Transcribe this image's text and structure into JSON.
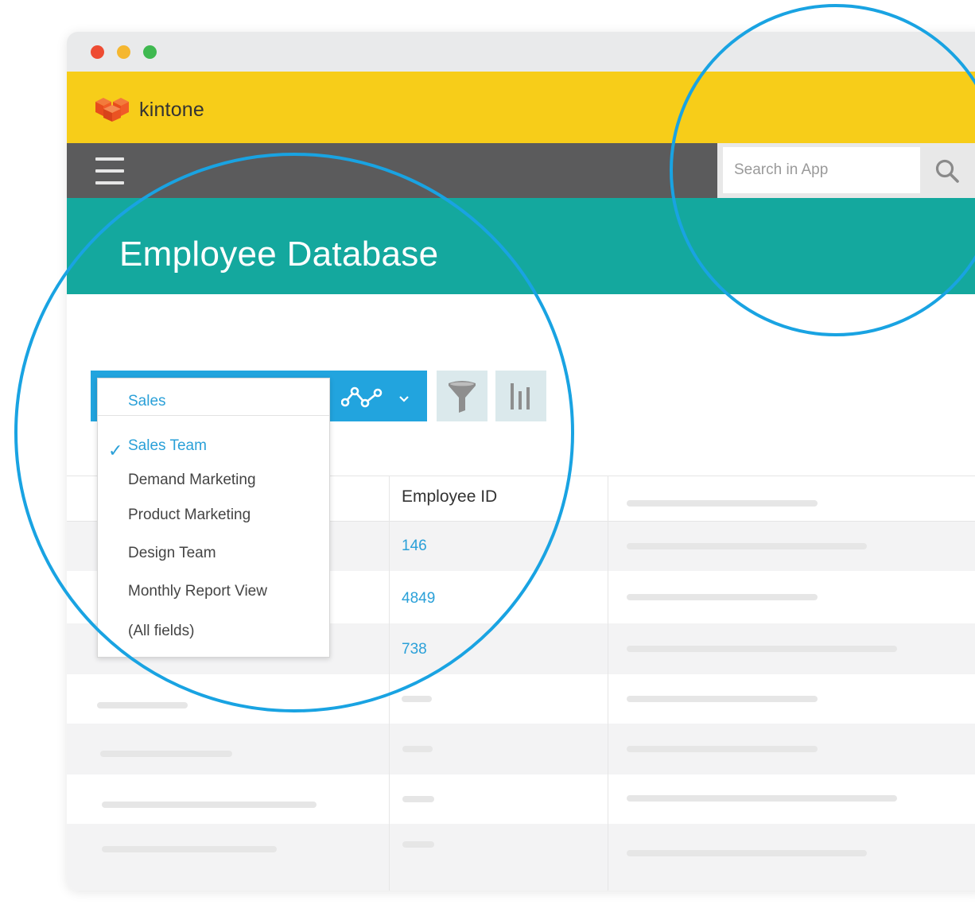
{
  "window": {
    "controls": [
      "close-control",
      "minimize-control",
      "maximize-control"
    ]
  },
  "brand": {
    "name": "kintone",
    "icon": "kintone-logo-icon",
    "logo_color": "#f05a28",
    "bar_color": "#f7cd19"
  },
  "nav": {
    "menu_icon": "hamburger-menu-icon",
    "search_placeholder": "Search in App",
    "search_icon": "search-icon"
  },
  "page": {
    "title": "Employee Database",
    "header_color": "#14a89e"
  },
  "toolbar": {
    "accent_color": "#22a4de",
    "graph_icon": "graph-icon",
    "chevron_icon": "chevron-down-icon",
    "filter_icon": "filter-funnel-icon",
    "chart_icon": "bar-chart-icon"
  },
  "view_dropdown": {
    "selected": "Sales",
    "check_icon": "check-icon",
    "items": [
      {
        "label": "Sales Team",
        "checked": true
      },
      {
        "label": "Demand Marketing",
        "checked": false
      },
      {
        "label": "Product Marketing",
        "checked": false
      },
      {
        "label": "Design Team",
        "checked": false
      },
      {
        "label": "Monthly Report View",
        "checked": false
      },
      {
        "label": "(All fields)",
        "checked": false
      }
    ]
  },
  "table": {
    "columns": [
      "Employee ID"
    ],
    "employee_ids": [
      "146",
      "4849",
      "738"
    ],
    "link_color": "#2aa0d8"
  },
  "highlight_color": "#19a3e2"
}
